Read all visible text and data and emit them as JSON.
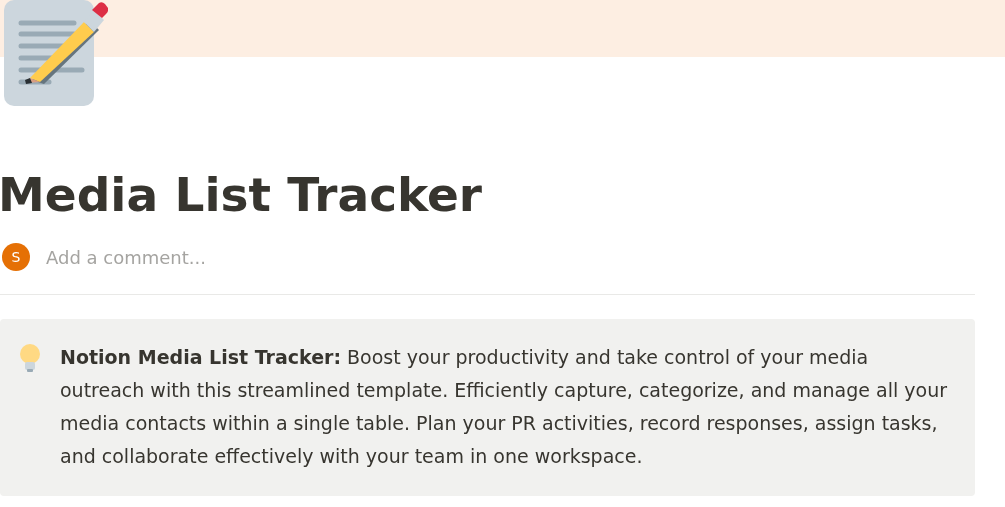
{
  "page": {
    "title": "Media List Tracker"
  },
  "comment": {
    "avatar": "S",
    "placeholder": "Add a comment..."
  },
  "callout": {
    "text": "**Notion Media List Tracker:** Boost your productivity and take control of your media outreach with this streamlined template. Efficiently capture, categorize, and manage all your media contacts within a single table. Plan your PR activities, record responses, assign tasks, and collaborate effectively with your team in one workspace."
  }
}
